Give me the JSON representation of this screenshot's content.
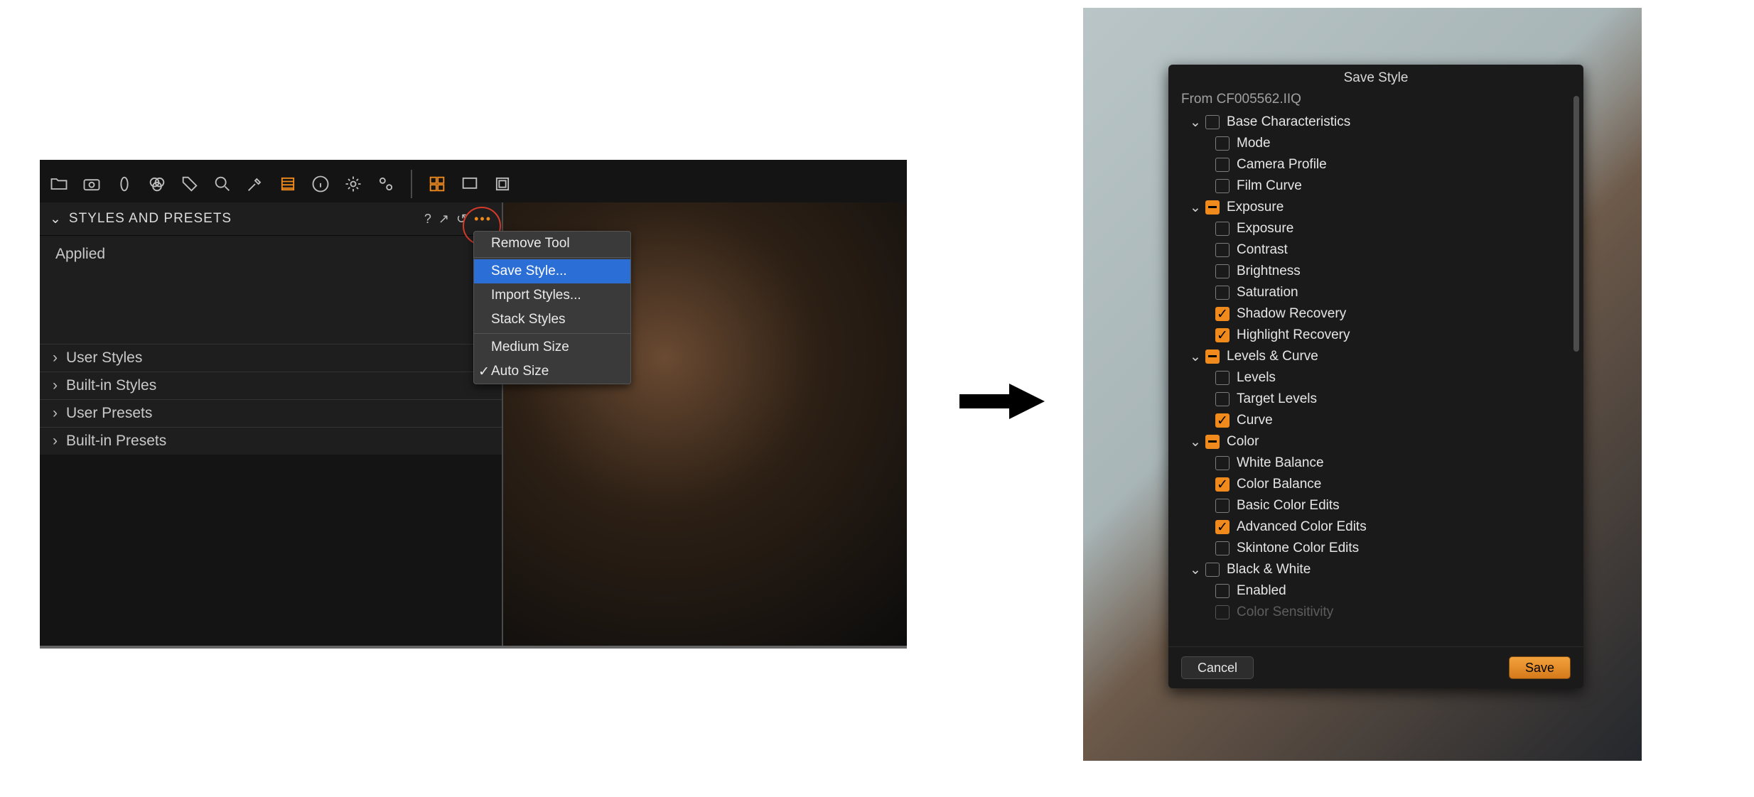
{
  "left": {
    "toolbar_icons": [
      "folder",
      "camera",
      "lens",
      "color",
      "tag",
      "search",
      "eyedropper",
      "adjust",
      "info",
      "gear",
      "gears",
      "grid",
      "screen",
      "crop"
    ],
    "panel_title": "STYLES AND PRESETS",
    "panel_tools": {
      "help": "?",
      "expand": "↗",
      "reset": "↺",
      "more": "•••"
    },
    "applied_label": "Applied",
    "rows": [
      "User Styles",
      "Built-in Styles",
      "User Presets",
      "Built-in Presets"
    ]
  },
  "context_menu": {
    "items": [
      {
        "label": "Remove Tool",
        "type": "item"
      },
      {
        "type": "sep"
      },
      {
        "label": "Save Style...",
        "type": "item",
        "selected": true
      },
      {
        "label": "Import Styles...",
        "type": "item"
      },
      {
        "label": "Stack Styles",
        "type": "item"
      },
      {
        "type": "sep"
      },
      {
        "label": "Medium Size",
        "type": "item"
      },
      {
        "label": "Auto Size",
        "type": "item",
        "checked": true
      }
    ]
  },
  "dialog": {
    "title": "Save Style",
    "from": "From CF005562.IIQ",
    "groups": [
      {
        "name": "Base Characteristics",
        "state": "off",
        "children": [
          {
            "name": "Mode",
            "state": "off"
          },
          {
            "name": "Camera Profile",
            "state": "off"
          },
          {
            "name": "Film Curve",
            "state": "off"
          }
        ]
      },
      {
        "name": "Exposure",
        "state": "mixed",
        "children": [
          {
            "name": "Exposure",
            "state": "off"
          },
          {
            "name": "Contrast",
            "state": "off"
          },
          {
            "name": "Brightness",
            "state": "off"
          },
          {
            "name": "Saturation",
            "state": "off"
          },
          {
            "name": "Shadow Recovery",
            "state": "on"
          },
          {
            "name": "Highlight Recovery",
            "state": "on"
          }
        ]
      },
      {
        "name": "Levels & Curve",
        "state": "mixed",
        "children": [
          {
            "name": "Levels",
            "state": "off"
          },
          {
            "name": "Target Levels",
            "state": "off"
          },
          {
            "name": "Curve",
            "state": "on"
          }
        ]
      },
      {
        "name": "Color",
        "state": "mixed",
        "children": [
          {
            "name": "White Balance",
            "state": "off"
          },
          {
            "name": "Color Balance",
            "state": "on"
          },
          {
            "name": "Basic Color Edits",
            "state": "off"
          },
          {
            "name": "Advanced Color Edits",
            "state": "on"
          },
          {
            "name": "Skintone Color Edits",
            "state": "off"
          }
        ]
      },
      {
        "name": "Black & White",
        "state": "off",
        "children": [
          {
            "name": "Enabled",
            "state": "off"
          },
          {
            "name": "Color Sensitivity",
            "state": "off",
            "fade": true
          }
        ]
      }
    ],
    "cancel": "Cancel",
    "save": "Save"
  }
}
